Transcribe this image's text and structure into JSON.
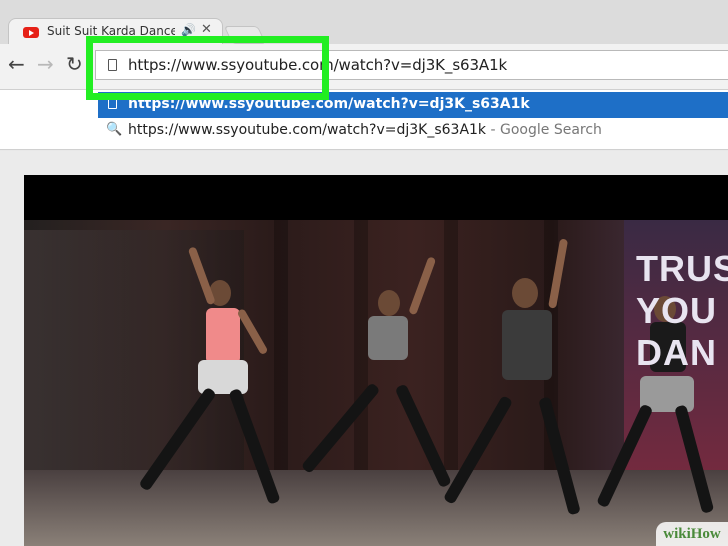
{
  "tab": {
    "title": "Suit Suit Karda Dance",
    "audio_icon": "speaker-icon",
    "close_glyph": "✕"
  },
  "toolbar": {
    "back_glyph": "←",
    "forward_glyph": "→",
    "reload_glyph": "↻"
  },
  "omnibox": {
    "value": "https://www.ssyoutube.com/watch?v=dj3K_s63A1k"
  },
  "suggestions": [
    {
      "text": "https://www.ssyoutube.com/watch?v=dj3K_s63A1k",
      "suffix": "",
      "icon": "page-icon",
      "selected": true
    },
    {
      "text": "https://www.ssyoutube.com/watch?v=dj3K_s63A1k",
      "suffix": " - Google Search",
      "icon": "search-icon",
      "selected": false
    }
  ],
  "video": {
    "poster_lines": [
      "TRUS",
      "YOU",
      "DAN"
    ]
  },
  "watermark": "wikiHow",
  "colors": {
    "highlight": "#22ee22",
    "selection": "#1e6fc7",
    "youtube_red": "#e62117"
  }
}
